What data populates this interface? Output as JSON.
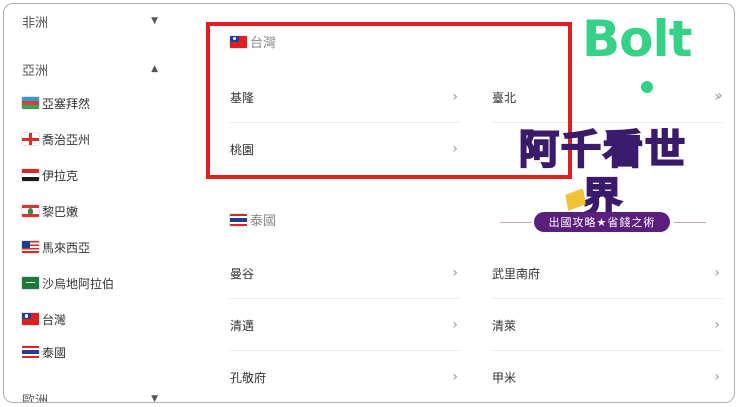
{
  "sidebar": {
    "sections": [
      {
        "label": "非洲",
        "chevron": "chevron-down-icon"
      },
      {
        "label": "亞洲",
        "chevron": "chevron-up-icon"
      },
      {
        "label": "歐洲",
        "chevron": "chevron-down-icon"
      }
    ],
    "countries": [
      {
        "label": "亞塞拜然",
        "flag": "azerbaijan-flag-icon"
      },
      {
        "label": "喬治亞州",
        "flag": "georgia-flag-icon"
      },
      {
        "label": "伊拉克",
        "flag": "iraq-flag-icon"
      },
      {
        "label": "黎巴嫩",
        "flag": "lebanon-flag-icon"
      },
      {
        "label": "馬來西亞",
        "flag": "malaysia-flag-icon"
      },
      {
        "label": "沙烏地阿拉伯",
        "flag": "saudi-arabia-flag-icon"
      },
      {
        "label": "台灣",
        "flag": "taiwan-flag-icon"
      },
      {
        "label": "泰國",
        "flag": "thailand-flag-icon"
      }
    ]
  },
  "groups": [
    {
      "title": "台灣",
      "cities": [
        "基隆",
        "臺北",
        "桃園"
      ]
    },
    {
      "title": "泰國",
      "cities": [
        "曼谷",
        "武里南府",
        "清邁",
        "清萊",
        "孔敬府",
        "甲米"
      ]
    }
  ],
  "logos": {
    "bolt": "Bolt",
    "site_title": "阿千看世界",
    "site_tagline": "出國攻略★省錢之術"
  },
  "colors": {
    "highlight": "#e11f1f",
    "bolt": "#34d186"
  }
}
